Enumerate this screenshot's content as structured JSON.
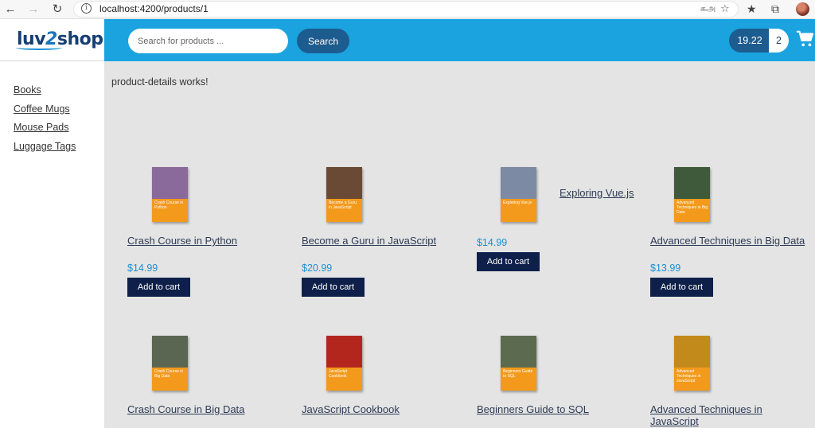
{
  "browser": {
    "url": "localhost:4200/products/1",
    "icons": [
      "back-icon",
      "forward-icon",
      "reload-icon",
      "info-icon",
      "translate-icon",
      "favorite-add-icon",
      "favorites-icon",
      "collections-icon"
    ]
  },
  "logo": {
    "part1": "luv",
    "part2": "2",
    "part3": "shop"
  },
  "categories": [
    "Books",
    "Coffee Mugs",
    "Mouse Pads",
    "Luggage Tags"
  ],
  "search": {
    "placeholder": "Search for products ...",
    "button_label": "Search"
  },
  "cart": {
    "total": "19.22",
    "quantity": "2"
  },
  "detail_message": "product-details works!",
  "add_to_cart_label": "Add to cart",
  "products": [
    {
      "name": "Crash Course in Python",
      "price": "$14.99",
      "cover_title": "Crash Course in Python",
      "art_color": "#8a6a9a"
    },
    {
      "name": "Become a Guru in JavaScript",
      "price": "$20.99",
      "cover_title": "Become a Guru in JavaScript",
      "art_color": "#6b4a35"
    },
    {
      "name": "Exploring Vue.js",
      "price": "$14.99",
      "cover_title": "Exploring Vue.js",
      "art_color": "#7d8aa3"
    },
    {
      "name": "Advanced Techniques in Big Data",
      "price": "$13.99",
      "cover_title": "Advanced Techniques in Big Data",
      "art_color": "#3f5a3a"
    },
    {
      "name": "Crash Course in Big Data",
      "cover_title": "Crash Course in Big Data",
      "art_color": "#5b6652"
    },
    {
      "name": "JavaScript Cookbook",
      "cover_title": "JavaScript Cookbook",
      "art_color": "#b3261e"
    },
    {
      "name": "Beginners Guide to SQL",
      "cover_title": "Beginners Guide to SQL",
      "art_color": "#5c6b4f"
    },
    {
      "name": "Advanced Techniques in JavaScript",
      "name_line1": "Advanced Techniques in",
      "name_line2": "JavaScript",
      "cover_title": "Advanced Techniques in JavaScript",
      "art_color": "#c28a1a"
    }
  ],
  "colors": {
    "header": "#1ba3e0",
    "button_dark": "#0e1f4a",
    "price": "#1a90d0",
    "cover_band": "#f39a1c"
  }
}
